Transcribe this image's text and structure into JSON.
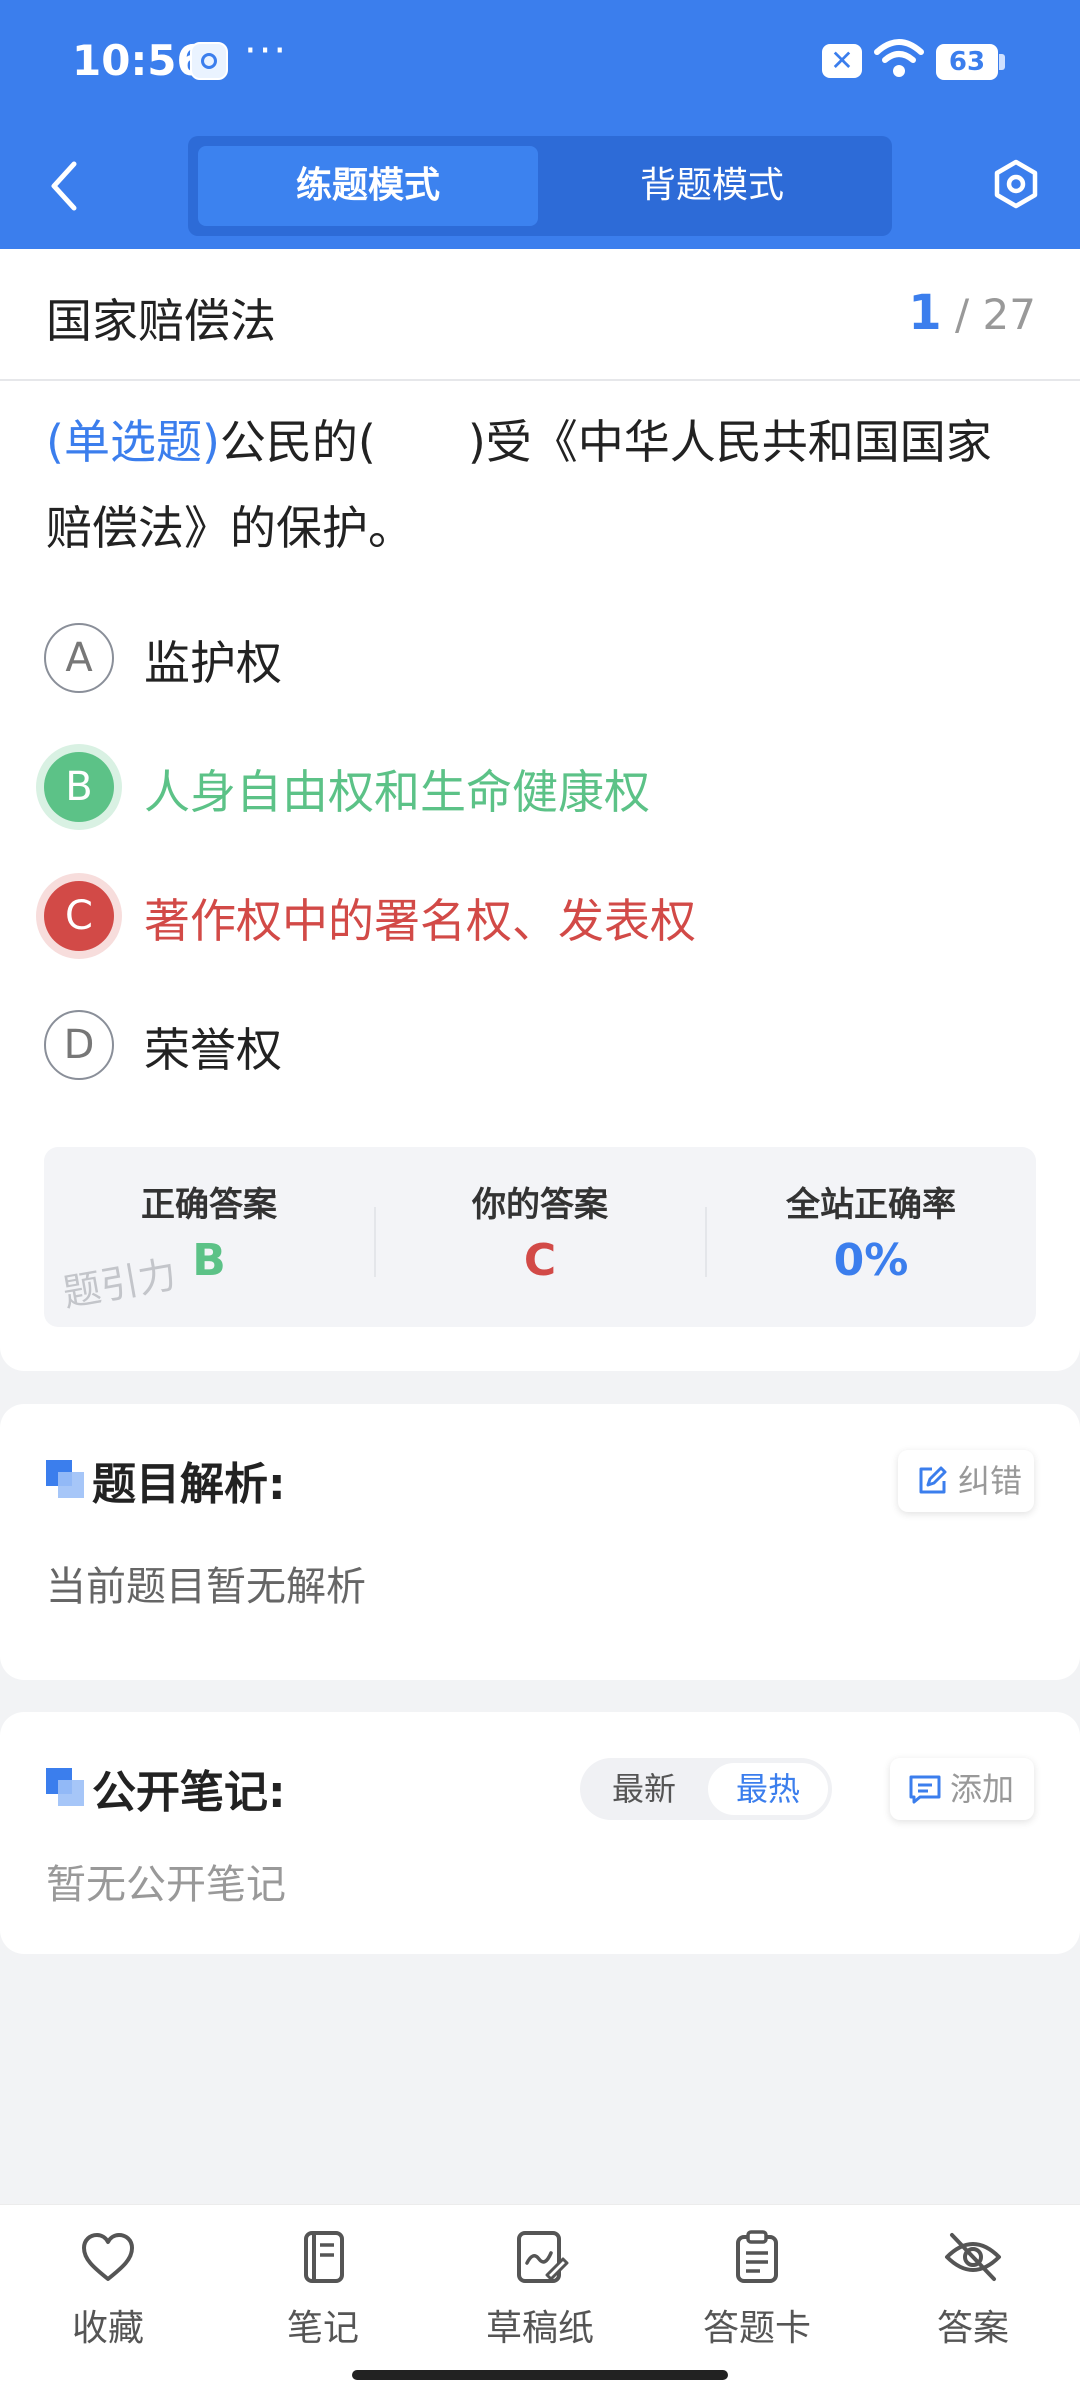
{
  "status_bar": {
    "time": "10:56",
    "dots": "···",
    "battery": "63"
  },
  "header": {
    "modes": [
      "练题模式",
      "背题模式"
    ],
    "active_mode_index": 0
  },
  "chapter": {
    "title": "国家赔偿法",
    "current": "1",
    "total": "/ 27"
  },
  "question": {
    "type": "(单选题)",
    "text": "公民的(　　)受《中华人民共和国国家赔偿法》的保护。"
  },
  "options": [
    {
      "letter": "A",
      "text": "监护权",
      "state": "normal"
    },
    {
      "letter": "B",
      "text": "人身自由权和生命健康权",
      "state": "correct"
    },
    {
      "letter": "C",
      "text": "著作权中的署名权、发表权",
      "state": "wrong"
    },
    {
      "letter": "D",
      "text": "荣誉权",
      "state": "normal"
    }
  ],
  "answer_summary": {
    "correct_label": "正确答案",
    "correct_value": "B",
    "yours_label": "你的答案",
    "yours_value": "C",
    "rate_label": "全站正确率",
    "rate_value": "0%",
    "watermark": "题引力"
  },
  "analysis": {
    "title": "题目解析:",
    "report_label": "纠错",
    "text": "当前题目暂无解析"
  },
  "notes": {
    "title": "公开笔记:",
    "sort_latest": "最新",
    "sort_hot": "最热",
    "sort_selected": "最热",
    "add_label": "添加",
    "empty_text": "暂无公开笔记"
  },
  "bottom_nav": [
    {
      "label": "收藏",
      "icon": "heart-icon"
    },
    {
      "label": "笔记",
      "icon": "notebook-icon"
    },
    {
      "label": "草稿纸",
      "icon": "draft-paper-icon"
    },
    {
      "label": "答题卡",
      "icon": "answer-sheet-icon"
    },
    {
      "label": "答案",
      "icon": "eye-off-icon"
    }
  ],
  "colors": {
    "primary": "#3b7eed",
    "correct": "#5cc287",
    "wrong": "#d24a47"
  }
}
